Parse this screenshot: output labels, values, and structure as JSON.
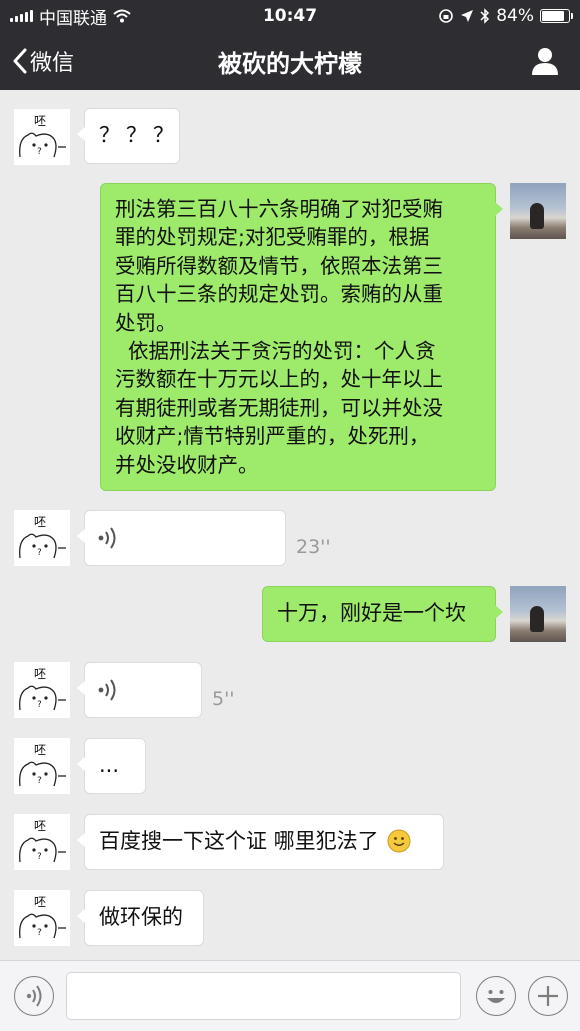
{
  "status_bar": {
    "carrier": "中国联通",
    "time": "10:47",
    "battery": "84%",
    "battery_level": 0.84
  },
  "nav": {
    "back_label": "微信",
    "title": "被砍的大柠檬"
  },
  "messages": [
    {
      "from": "other",
      "type": "text",
      "text": "？？？"
    },
    {
      "from": "me",
      "type": "text",
      "lines": [
        "刑法第三百八十六条明确了对犯受贿",
        "罪的处罚规定;对犯受贿罪的，根据",
        "受贿所得数额及情节，依照本法第三",
        "百八十三条的规定处罚。索贿的从重",
        "处罚。",
        "  依据刑法关于贪污的处罚：个人贪",
        "污数额在十万元以上的，处十年以上",
        "有期徒刑或者无期徒刑，可以并处没",
        "收财产;情节特别严重的，处死刑，",
        "并处没收财产。"
      ]
    },
    {
      "from": "other",
      "type": "voice",
      "duration": "23''"
    },
    {
      "from": "me",
      "type": "text",
      "text": "十万，刚好是一个坎"
    },
    {
      "from": "other",
      "type": "voice",
      "duration": "5''"
    },
    {
      "from": "other",
      "type": "text",
      "text": "..."
    },
    {
      "from": "other",
      "type": "text",
      "text": "百度搜一下这个证 哪里犯法了",
      "emoji": "smile-emoji"
    },
    {
      "from": "other",
      "type": "text",
      "text": "做环保的"
    }
  ],
  "avatar_other": {
    "glyph": "呸",
    "icon": "bear-sticker-avatar"
  },
  "avatar_me": {
    "icon": "seaside-photo-avatar"
  },
  "input_bar": {
    "voice_icon": "voice-toggle-icon",
    "emoji_icon": "emoji-icon",
    "plus_icon": "plus-icon",
    "value": ""
  }
}
